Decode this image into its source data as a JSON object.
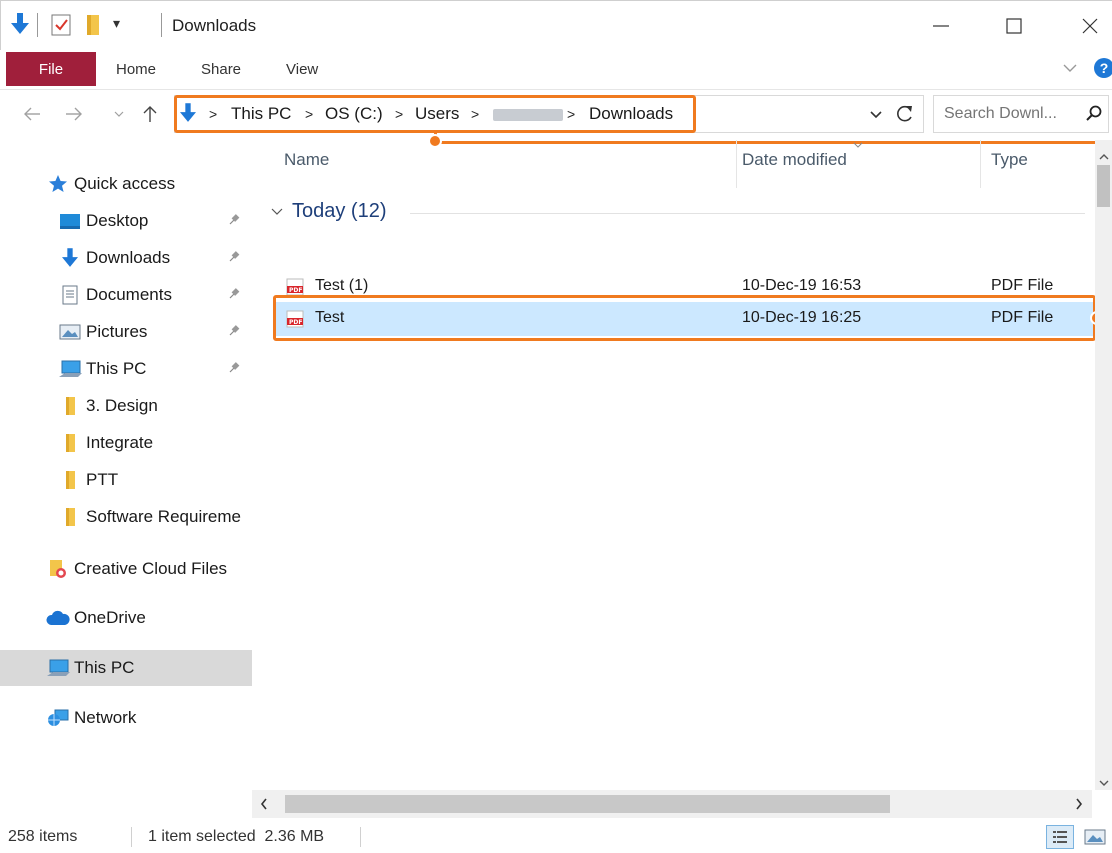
{
  "window": {
    "title": "Downloads",
    "qat_dropdown": "▾"
  },
  "ribbon": {
    "tabs": [
      "File",
      "Home",
      "Share",
      "View"
    ]
  },
  "address": {
    "crumbs": [
      "This PC",
      "OS (C:)",
      "Users",
      "Downloads"
    ],
    "separator": ">",
    "refresh_icon": "refresh-icon"
  },
  "search": {
    "placeholder": "Search Downl..."
  },
  "sidebar": {
    "quick_access": "Quick access",
    "items": [
      {
        "label": "Desktop",
        "icon": "desktop-icon",
        "pinned": true
      },
      {
        "label": "Downloads",
        "icon": "download-icon",
        "pinned": true
      },
      {
        "label": "Documents",
        "icon": "documents-icon",
        "pinned": true
      },
      {
        "label": "Pictures",
        "icon": "pictures-icon",
        "pinned": true
      },
      {
        "label": "This PC",
        "icon": "computer-icon",
        "pinned": true
      },
      {
        "label": "3. Design",
        "icon": "folder-icon",
        "pinned": false
      },
      {
        "label": "Integrate",
        "icon": "folder-icon",
        "pinned": false
      },
      {
        "label": "PTT",
        "icon": "folder-icon",
        "pinned": false
      },
      {
        "label": "Software Requireme",
        "icon": "folder-icon",
        "pinned": false
      }
    ],
    "creative_cloud": "Creative Cloud Files",
    "onedrive": "OneDrive",
    "this_pc": "This PC",
    "network": "Network"
  },
  "columns": {
    "name": "Name",
    "date": "Date modified",
    "type": "Type"
  },
  "group": {
    "label": "Today (12)"
  },
  "files": [
    {
      "name": "Test (1)",
      "date": "10-Dec-19 16:53",
      "type": "PDF File",
      "selected": false
    },
    {
      "name": "Test",
      "date": "10-Dec-19 16:25",
      "type": "PDF File",
      "selected": true
    }
  ],
  "status": {
    "count": "258 items",
    "selection": "1 item selected  2.36 MB"
  },
  "colors": {
    "file_tab": "#a01f3b",
    "selection": "#cce8ff",
    "callout": "#f07a1f",
    "group_text": "#1e3f7a"
  }
}
